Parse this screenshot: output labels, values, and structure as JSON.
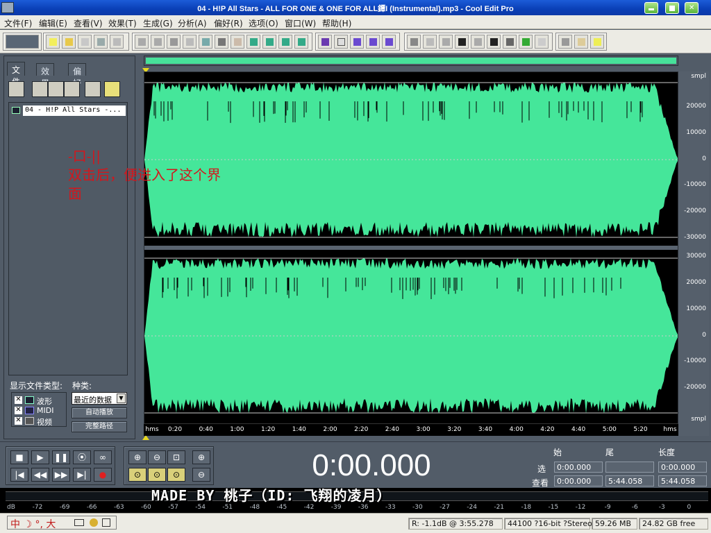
{
  "window": {
    "title": "04 - H!P All Stars - ALL FOR ONE & ONE FOR ALL鐔I (Instrumental).mp3 - Cool Edit Pro"
  },
  "menu": {
    "file": "文件(F)",
    "edit": "编辑(E)",
    "view": "查看(V)",
    "effects": "效果(T)",
    "generate": "生成(G)",
    "analyze": "分析(A)",
    "favorites": "偏好(R)",
    "options": "选项(O)",
    "window": "窗口(W)",
    "help": "帮助(H)"
  },
  "left_panel": {
    "tabs": [
      "文件",
      "效果",
      "偏好"
    ],
    "file_item": "04 - H!P All Stars -...",
    "show_types_label": "显示文件类型:",
    "kind_label": "种类:",
    "types": [
      "波形",
      "MIDI",
      "视频"
    ],
    "recent_select": "最近的数据",
    "auto_play": "自动播放",
    "full_path": "完整路径"
  },
  "annotation": {
    "line1": "-口-||",
    "line2": "双击后，便进入了这个界",
    "line3": "面"
  },
  "wave": {
    "top_unit": "smpl",
    "bottom_unit": "smpl",
    "ch1_labels": [
      "20000",
      "10000",
      "0",
      "-10000",
      "-20000",
      "-30000"
    ],
    "ch2_labels": [
      "30000",
      "20000",
      "10000",
      "0",
      "-10000",
      "-20000"
    ],
    "color": "#45e69a",
    "time_ticks": [
      "hms",
      "0:20",
      "0:40",
      "1:00",
      "1:20",
      "1:40",
      "2:00",
      "2:20",
      "2:40",
      "3:00",
      "3:20",
      "3:40",
      "4:00",
      "4:20",
      "4:40",
      "5:00",
      "5:20",
      "hms"
    ]
  },
  "transport": {
    "clock": "0:00.000",
    "hdr_begin": "始",
    "hdr_end": "尾",
    "hdr_length": "长度",
    "row_sel": "选",
    "row_view": "查看",
    "sel_begin": "0:00.000",
    "sel_end": "",
    "sel_length": "0:00.000",
    "view_begin": "0:00.000",
    "view_end": "5:44.058",
    "view_length": "5:44.058"
  },
  "meter": {
    "labels": [
      "dB",
      "-72",
      "-69",
      "-66",
      "-63",
      "-60",
      "-57",
      "-54",
      "-51",
      "-48",
      "-45",
      "-42",
      "-39",
      "-36",
      "-33",
      "-30",
      "-27",
      "-24",
      "-21",
      "-18",
      "-15",
      "-12",
      "-9",
      "-6",
      "-3",
      "0"
    ]
  },
  "watermark": "MADE BY 桃子（ID: 飞翔的凌月）",
  "status": {
    "ime": "中 ☽ °, 大",
    "level": "R: -1.1dB @   3:55.278",
    "format": "44100 ?16-bit ?Stereo",
    "size": "59.26 MB",
    "free": "24.82 GB free"
  }
}
